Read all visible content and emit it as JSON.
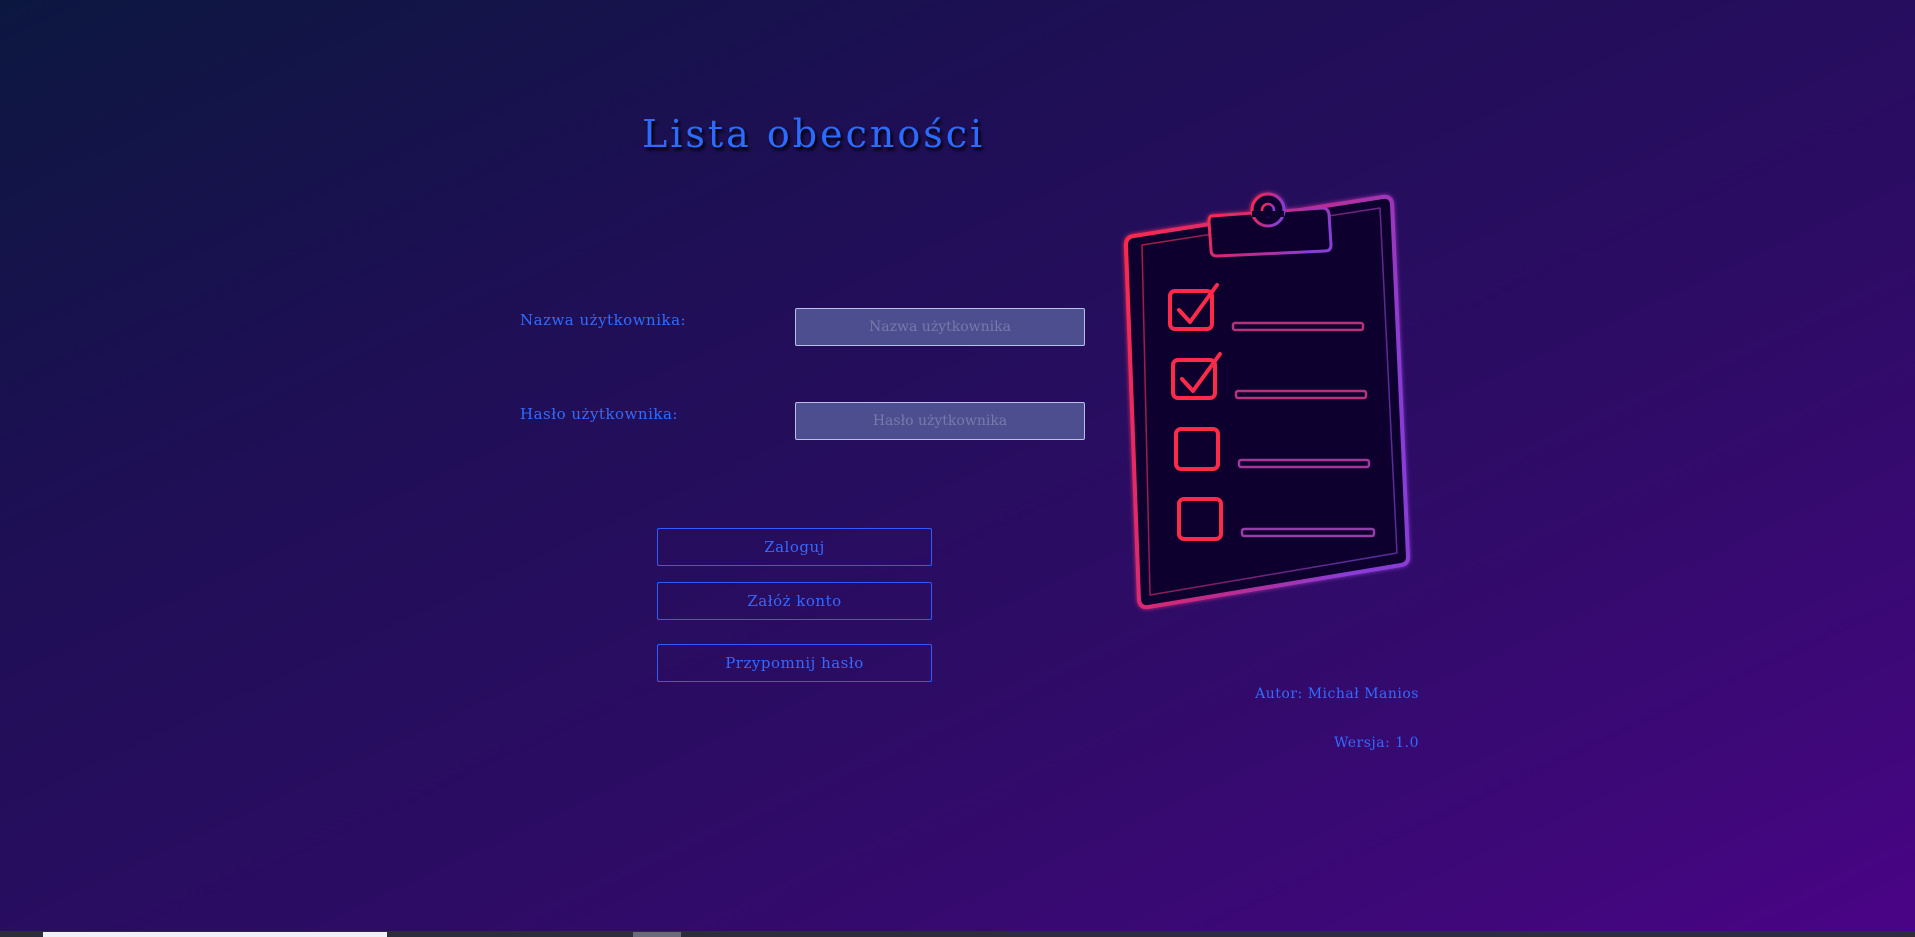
{
  "app": {
    "title": "Lista obecności"
  },
  "login_form": {
    "username": {
      "label": "Nazwa użytkownika:",
      "placeholder": "Nazwa użytkownika",
      "value": ""
    },
    "password": {
      "label": "Hasło użytkownika:",
      "placeholder": "Hasło użytkownika",
      "value": ""
    },
    "buttons": {
      "login": "Zaloguj",
      "register": "Załóż konto",
      "recover_password": "Przypomnij hasło"
    }
  },
  "footer": {
    "author": "Autor: Michał Manios",
    "version": "Wersja: 1.0"
  },
  "illustration": {
    "icon": "clipboard-checklist-icon",
    "checked_items": 2,
    "unchecked_items": 2
  },
  "colors": {
    "accent": "#2f6cff",
    "background_start": "#0c1740",
    "background_end": "#4a0386",
    "neon_red": "#ff2a4a",
    "neon_purple": "#8a3dd6",
    "input_background": "#4c4e90"
  }
}
